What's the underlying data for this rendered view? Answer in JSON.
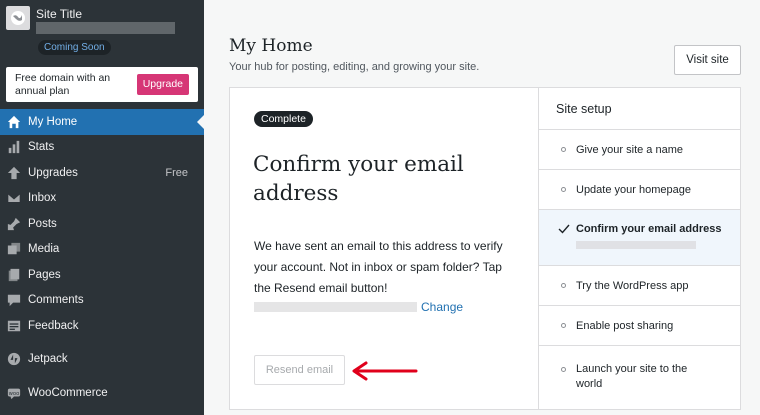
{
  "site": {
    "title": "Site Title",
    "status": "Coming Soon"
  },
  "upgrade_prompt": {
    "text": "Free domain with an annual plan",
    "button": "Upgrade"
  },
  "nav": [
    {
      "label": "My Home",
      "icon": "home-icon",
      "active": true
    },
    {
      "label": "Stats",
      "icon": "stats-icon"
    },
    {
      "label": "Upgrades",
      "icon": "upgrades-icon",
      "badge": "Free"
    },
    {
      "label": "Inbox",
      "icon": "inbox-icon"
    },
    {
      "label": "Posts",
      "icon": "posts-icon"
    },
    {
      "label": "Media",
      "icon": "media-icon"
    },
    {
      "label": "Pages",
      "icon": "pages-icon"
    },
    {
      "label": "Comments",
      "icon": "comments-icon"
    },
    {
      "label": "Feedback",
      "icon": "feedback-icon"
    },
    {
      "label": "Jetpack",
      "icon": "jetpack-icon"
    },
    {
      "label": "WooCommerce",
      "icon": "woocommerce-icon"
    }
  ],
  "header": {
    "title": "My Home",
    "subtitle": "Your hub for posting, editing, and growing your site.",
    "visit_button": "Visit site"
  },
  "task": {
    "badge": "Complete",
    "title": "Confirm your email address",
    "description": "We have sent an email to this address to verify your account. Not in inbox or spam folder? Tap the Resend email button!",
    "change_link": "Change",
    "resend_button": "Resend email"
  },
  "setup": {
    "heading": "Site setup",
    "items": [
      {
        "label": "Give your site a name",
        "state": "pending"
      },
      {
        "label": "Update your homepage",
        "state": "pending"
      },
      {
        "label": "Confirm your email address",
        "state": "current"
      },
      {
        "label": "Try the WordPress app",
        "state": "pending"
      },
      {
        "label": "Enable post sharing",
        "state": "pending"
      },
      {
        "label": "Launch your site to the world",
        "state": "pending"
      }
    ]
  },
  "colors": {
    "sidebar_bg": "#2c3338",
    "active_blue": "#2271b1",
    "upgrade_pink": "#d63676",
    "arrow_red": "#e0001b"
  }
}
